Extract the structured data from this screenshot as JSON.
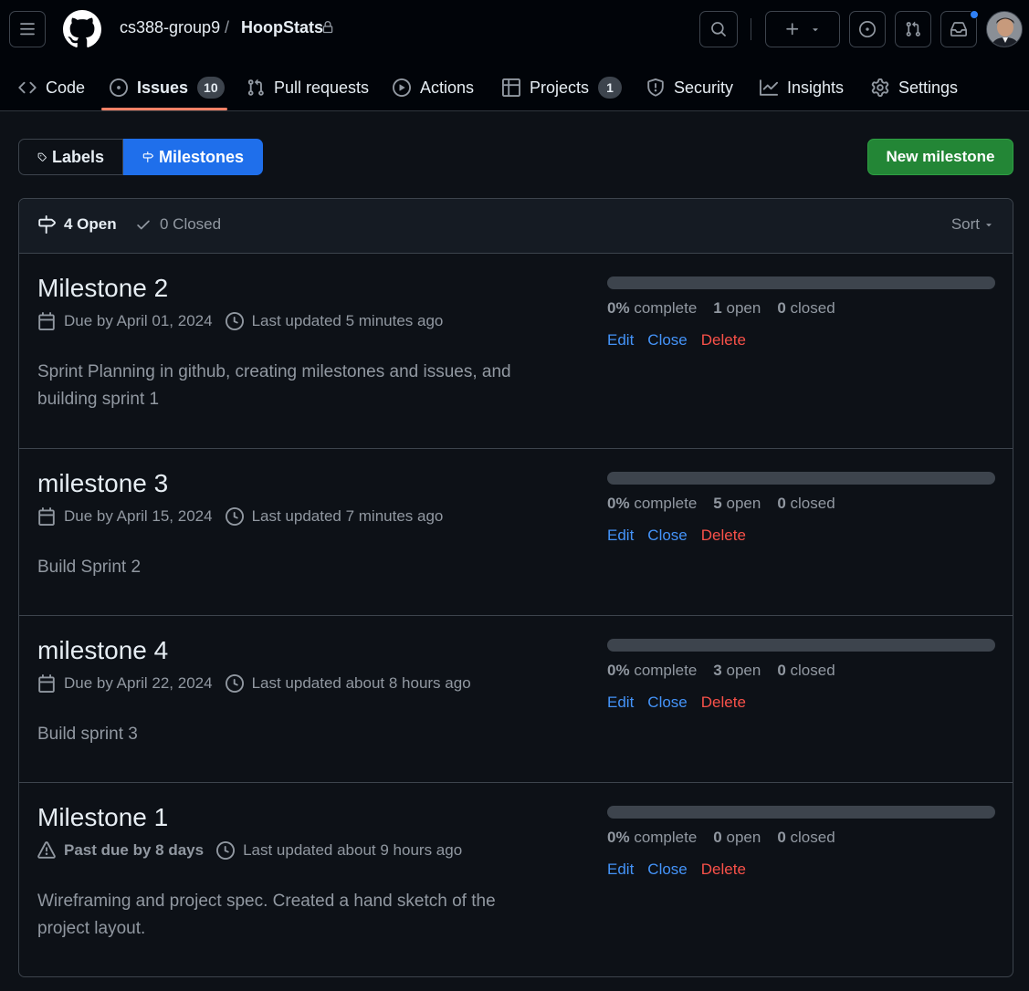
{
  "header": {
    "owner": "cs388-group9",
    "separator": "/",
    "repo": "HoopStats"
  },
  "nav": {
    "code": "Code",
    "issues": "Issues",
    "issues_count": "10",
    "pull_requests": "Pull requests",
    "actions": "Actions",
    "projects": "Projects",
    "projects_count": "1",
    "security": "Security",
    "insights": "Insights",
    "settings": "Settings"
  },
  "subnav": {
    "labels": "Labels",
    "milestones": "Milestones"
  },
  "new_milestone": "New milestone",
  "states": {
    "open": "4 Open",
    "closed": "0 Closed",
    "sort": "Sort"
  },
  "milestones": [
    {
      "title": "Milestone 2",
      "due": "Due by April 01, 2024",
      "updated": "Last updated 5 minutes ago",
      "description": "Sprint Planning in github, creating milestones and issues, and building sprint 1",
      "percent": "0%",
      "percent_label": "complete",
      "open_count": "1",
      "open_label": "open",
      "closed_count": "0",
      "closed_label": "closed",
      "progress": 0,
      "edit": "Edit",
      "close": "Close",
      "delete": "Delete"
    },
    {
      "title": "milestone 3",
      "due": "Due by April 15, 2024",
      "updated": "Last updated 7 minutes ago",
      "description": "Build Sprint 2",
      "percent": "0%",
      "percent_label": "complete",
      "open_count": "5",
      "open_label": "open",
      "closed_count": "0",
      "closed_label": "closed",
      "progress": 0,
      "edit": "Edit",
      "close": "Close",
      "delete": "Delete"
    },
    {
      "title": "milestone 4",
      "due": "Due by April 22, 2024",
      "updated": "Last updated about 8 hours ago",
      "description": "Build sprint 3",
      "percent": "0%",
      "percent_label": "complete",
      "open_count": "3",
      "open_label": "open",
      "closed_count": "0",
      "closed_label": "closed",
      "progress": 0,
      "edit": "Edit",
      "close": "Close",
      "delete": "Delete"
    },
    {
      "title": "Milestone 1",
      "due": "Past due by 8 days",
      "updated": "Last updated about 9 hours ago",
      "description": "Wireframing and project spec. Created a hand sketch of the project layout.",
      "percent": "0%",
      "percent_label": "complete",
      "open_count": "0",
      "open_label": "open",
      "closed_count": "0",
      "closed_label": "closed",
      "progress": 0,
      "edit": "Edit",
      "close": "Close",
      "delete": "Delete"
    }
  ],
  "colors": {
    "background": "#0d1117",
    "header_bg": "#010409",
    "accent_blue": "#1f6feb",
    "link_blue": "#4493f8",
    "primary_green": "#238636",
    "danger_red": "#f85149",
    "tab_underline": "#f78166"
  }
}
